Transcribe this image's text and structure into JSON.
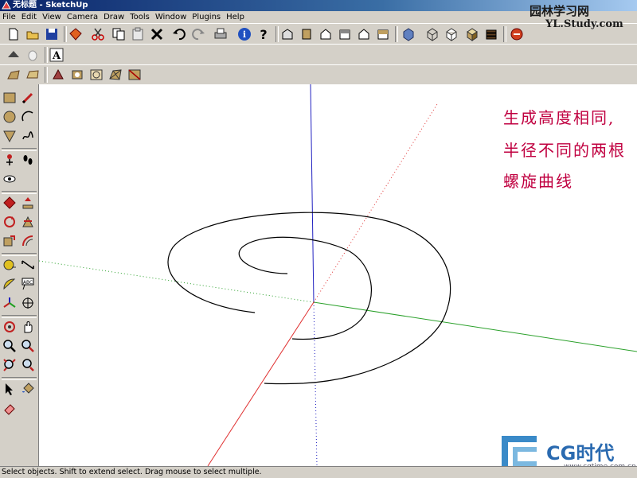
{
  "window": {
    "title": "无标题 - SketchUp"
  },
  "menu": [
    "File",
    "Edit",
    "View",
    "Camera",
    "Draw",
    "Tools",
    "Window",
    "Plugins",
    "Help"
  ],
  "annotation": {
    "line1": "生成高度相同,",
    "line2": "半径不同的两根",
    "line3": "螺旋曲线"
  },
  "status": {
    "text": "Select objects. Shift to extend select. Drag mouse to select multiple."
  },
  "watermark_top": {
    "title": "园林学习网",
    "url": "YL.Study.com"
  },
  "watermark_bottom": {
    "brand": "CG时代",
    "url": "www.cgtime.com.cn"
  },
  "colors": {
    "axis_red": "#e03030",
    "axis_green": "#2aa02a",
    "axis_blue": "#2020c0",
    "annotation": "#c00040"
  }
}
